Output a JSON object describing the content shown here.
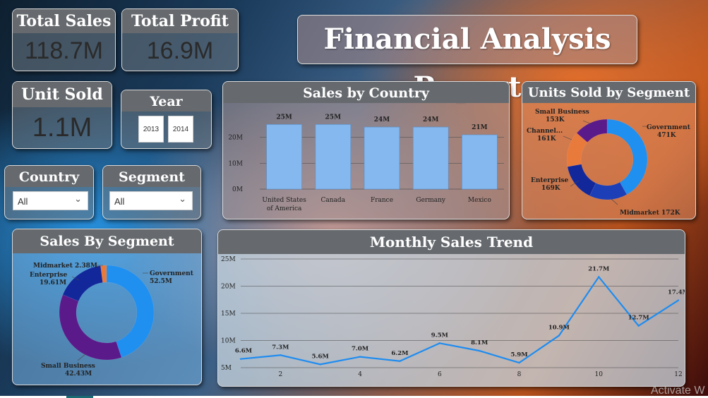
{
  "report_title": "Financial Analysis Report",
  "kpis": {
    "total_sales": {
      "label": "Total Sales",
      "value": "118.7M"
    },
    "total_profit": {
      "label": "Total Profit",
      "value": "16.9M"
    },
    "unit_sold": {
      "label": "Unit Sold",
      "value": "1.1M"
    }
  },
  "slicers": {
    "year": {
      "label": "Year",
      "options": [
        "2013",
        "2014"
      ]
    },
    "country": {
      "label": "Country",
      "value": "All"
    },
    "segment": {
      "label": "Segment",
      "value": "All"
    }
  },
  "watermark": "Activate W",
  "colors": {
    "bar": "#85b8ee",
    "line": "#1e8cf0",
    "donut_government": "#1f8ff0",
    "donut_midmarket": "#1c3fb8",
    "donut_enterprise": "#12289a",
    "donut_channel": "#e87a3c",
    "donut_small_business": "#5b1a8a",
    "sbs_government": "#1f8ff0",
    "sbs_small_business": "#5b1a8a",
    "sbs_enterprise": "#12289a",
    "sbs_midmarket": "#e87a3c"
  },
  "chart_data": [
    {
      "type": "bar",
      "title": "Sales by Country",
      "categories": [
        "United States of America",
        "Canada",
        "France",
        "Germany",
        "Mexico"
      ],
      "values": [
        25,
        25,
        24,
        24,
        21
      ],
      "data_labels": [
        "25M",
        "25M",
        "24M",
        "24M",
        "21M"
      ],
      "y_ticks": [
        "0M",
        "10M",
        "20M"
      ],
      "ylim": [
        0,
        30
      ],
      "grid": true
    },
    {
      "type": "pie",
      "title": "Units Sold by Segment",
      "slices": [
        {
          "name": "Government",
          "value": 471,
          "label": "471K"
        },
        {
          "name": "Midmarket",
          "value": 172,
          "label": "172K"
        },
        {
          "name": "Enterprise",
          "value": 169,
          "label": "169K"
        },
        {
          "name": "Channel...",
          "value": 161,
          "label": "161K"
        },
        {
          "name": "Small Business",
          "value": 153,
          "label": "153K"
        }
      ]
    },
    {
      "type": "pie",
      "title": "Sales By Segment",
      "slices": [
        {
          "name": "Government",
          "value": 52.5,
          "label": "52.5M"
        },
        {
          "name": "Small Business",
          "value": 42.43,
          "label": "42.43M"
        },
        {
          "name": "Enterprise",
          "value": 19.61,
          "label": "19.61M"
        },
        {
          "name": "Midmarket",
          "value": 2.38,
          "label": "2.38M"
        }
      ]
    },
    {
      "type": "line",
      "title": "Monthly Sales Trend",
      "x": [
        1,
        2,
        3,
        4,
        5,
        6,
        7,
        8,
        9,
        10,
        11,
        12
      ],
      "y": [
        6.6,
        7.3,
        5.6,
        7.0,
        6.2,
        9.5,
        8.1,
        5.9,
        10.9,
        21.7,
        12.7,
        17.4
      ],
      "data_labels": [
        "6.6M",
        "7.3M",
        "5.6M",
        "7.0M",
        "6.2M",
        "9.5M",
        "8.1M",
        "5.9M",
        "10.9M",
        "21.7M",
        "12.7M",
        "17.4M"
      ],
      "x_ticks": [
        "2",
        "4",
        "6",
        "8",
        "10",
        "12"
      ],
      "y_ticks": [
        "5M",
        "10M",
        "15M",
        "20M",
        "25M"
      ],
      "ylim": [
        5,
        25
      ],
      "xlim": [
        1,
        12
      ],
      "grid": true
    }
  ]
}
